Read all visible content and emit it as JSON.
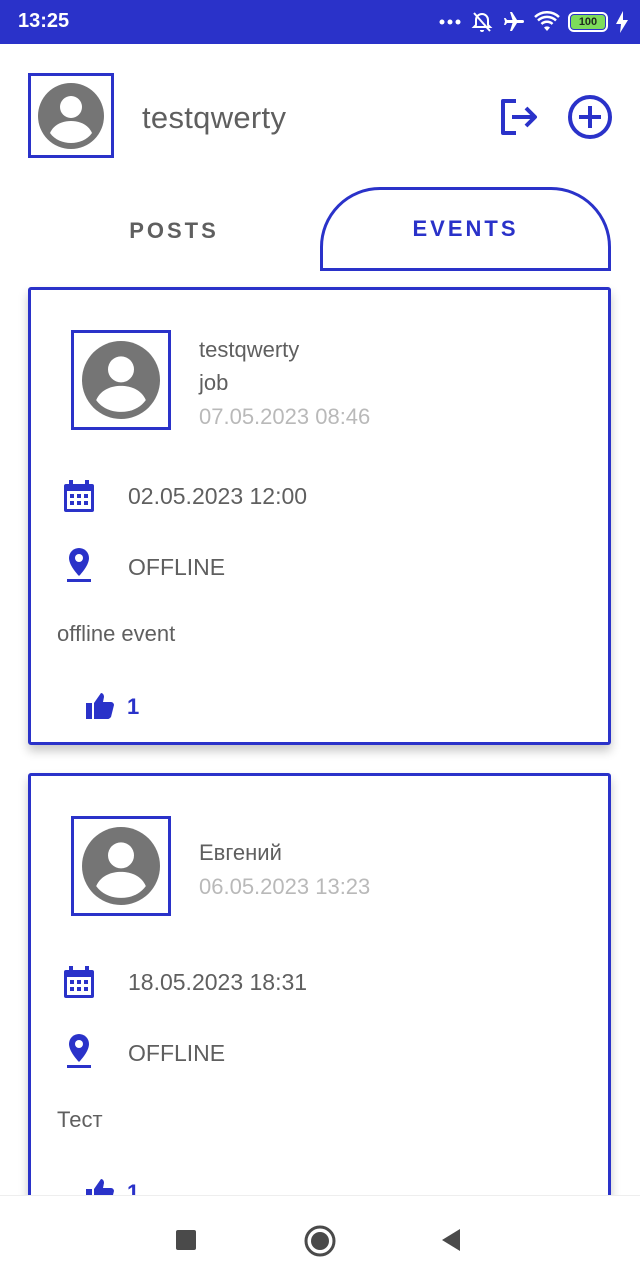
{
  "status_bar": {
    "time": "13:25",
    "battery": "100",
    "icons": [
      "more-dots-icon",
      "alarm-off-icon",
      "airplane-icon",
      "wifi-icon",
      "battery-icon",
      "charging-icon"
    ]
  },
  "header": {
    "username": "testqwerty",
    "avatar_icon": "avatar-icon",
    "logout_icon": "logout-icon",
    "add_icon": "add-circle-icon"
  },
  "tabs": [
    {
      "label": "POSTS",
      "selected": false
    },
    {
      "label": "EVENTS",
      "selected": true
    }
  ],
  "events": [
    {
      "author": "testqwerty",
      "job": "job",
      "published": "07.05.2023 08:46",
      "datetime": "02.05.2023 12:00",
      "type": "OFFLINE",
      "content": "offline event",
      "likes": "1"
    },
    {
      "author": "Евгений",
      "published": "06.05.2023 13:23",
      "datetime": "18.05.2023 18:31",
      "type": "OFFLINE",
      "content": "Тест",
      "likes": "1"
    }
  ],
  "colors": {
    "accent": "#2a32c9",
    "text": "#5f5f5f",
    "muted": "#b9b9b9",
    "status_bar": "#2a32c9"
  },
  "nav": {
    "icons": [
      "recents-square-icon",
      "home-circle-icon",
      "back-triangle-icon"
    ]
  }
}
